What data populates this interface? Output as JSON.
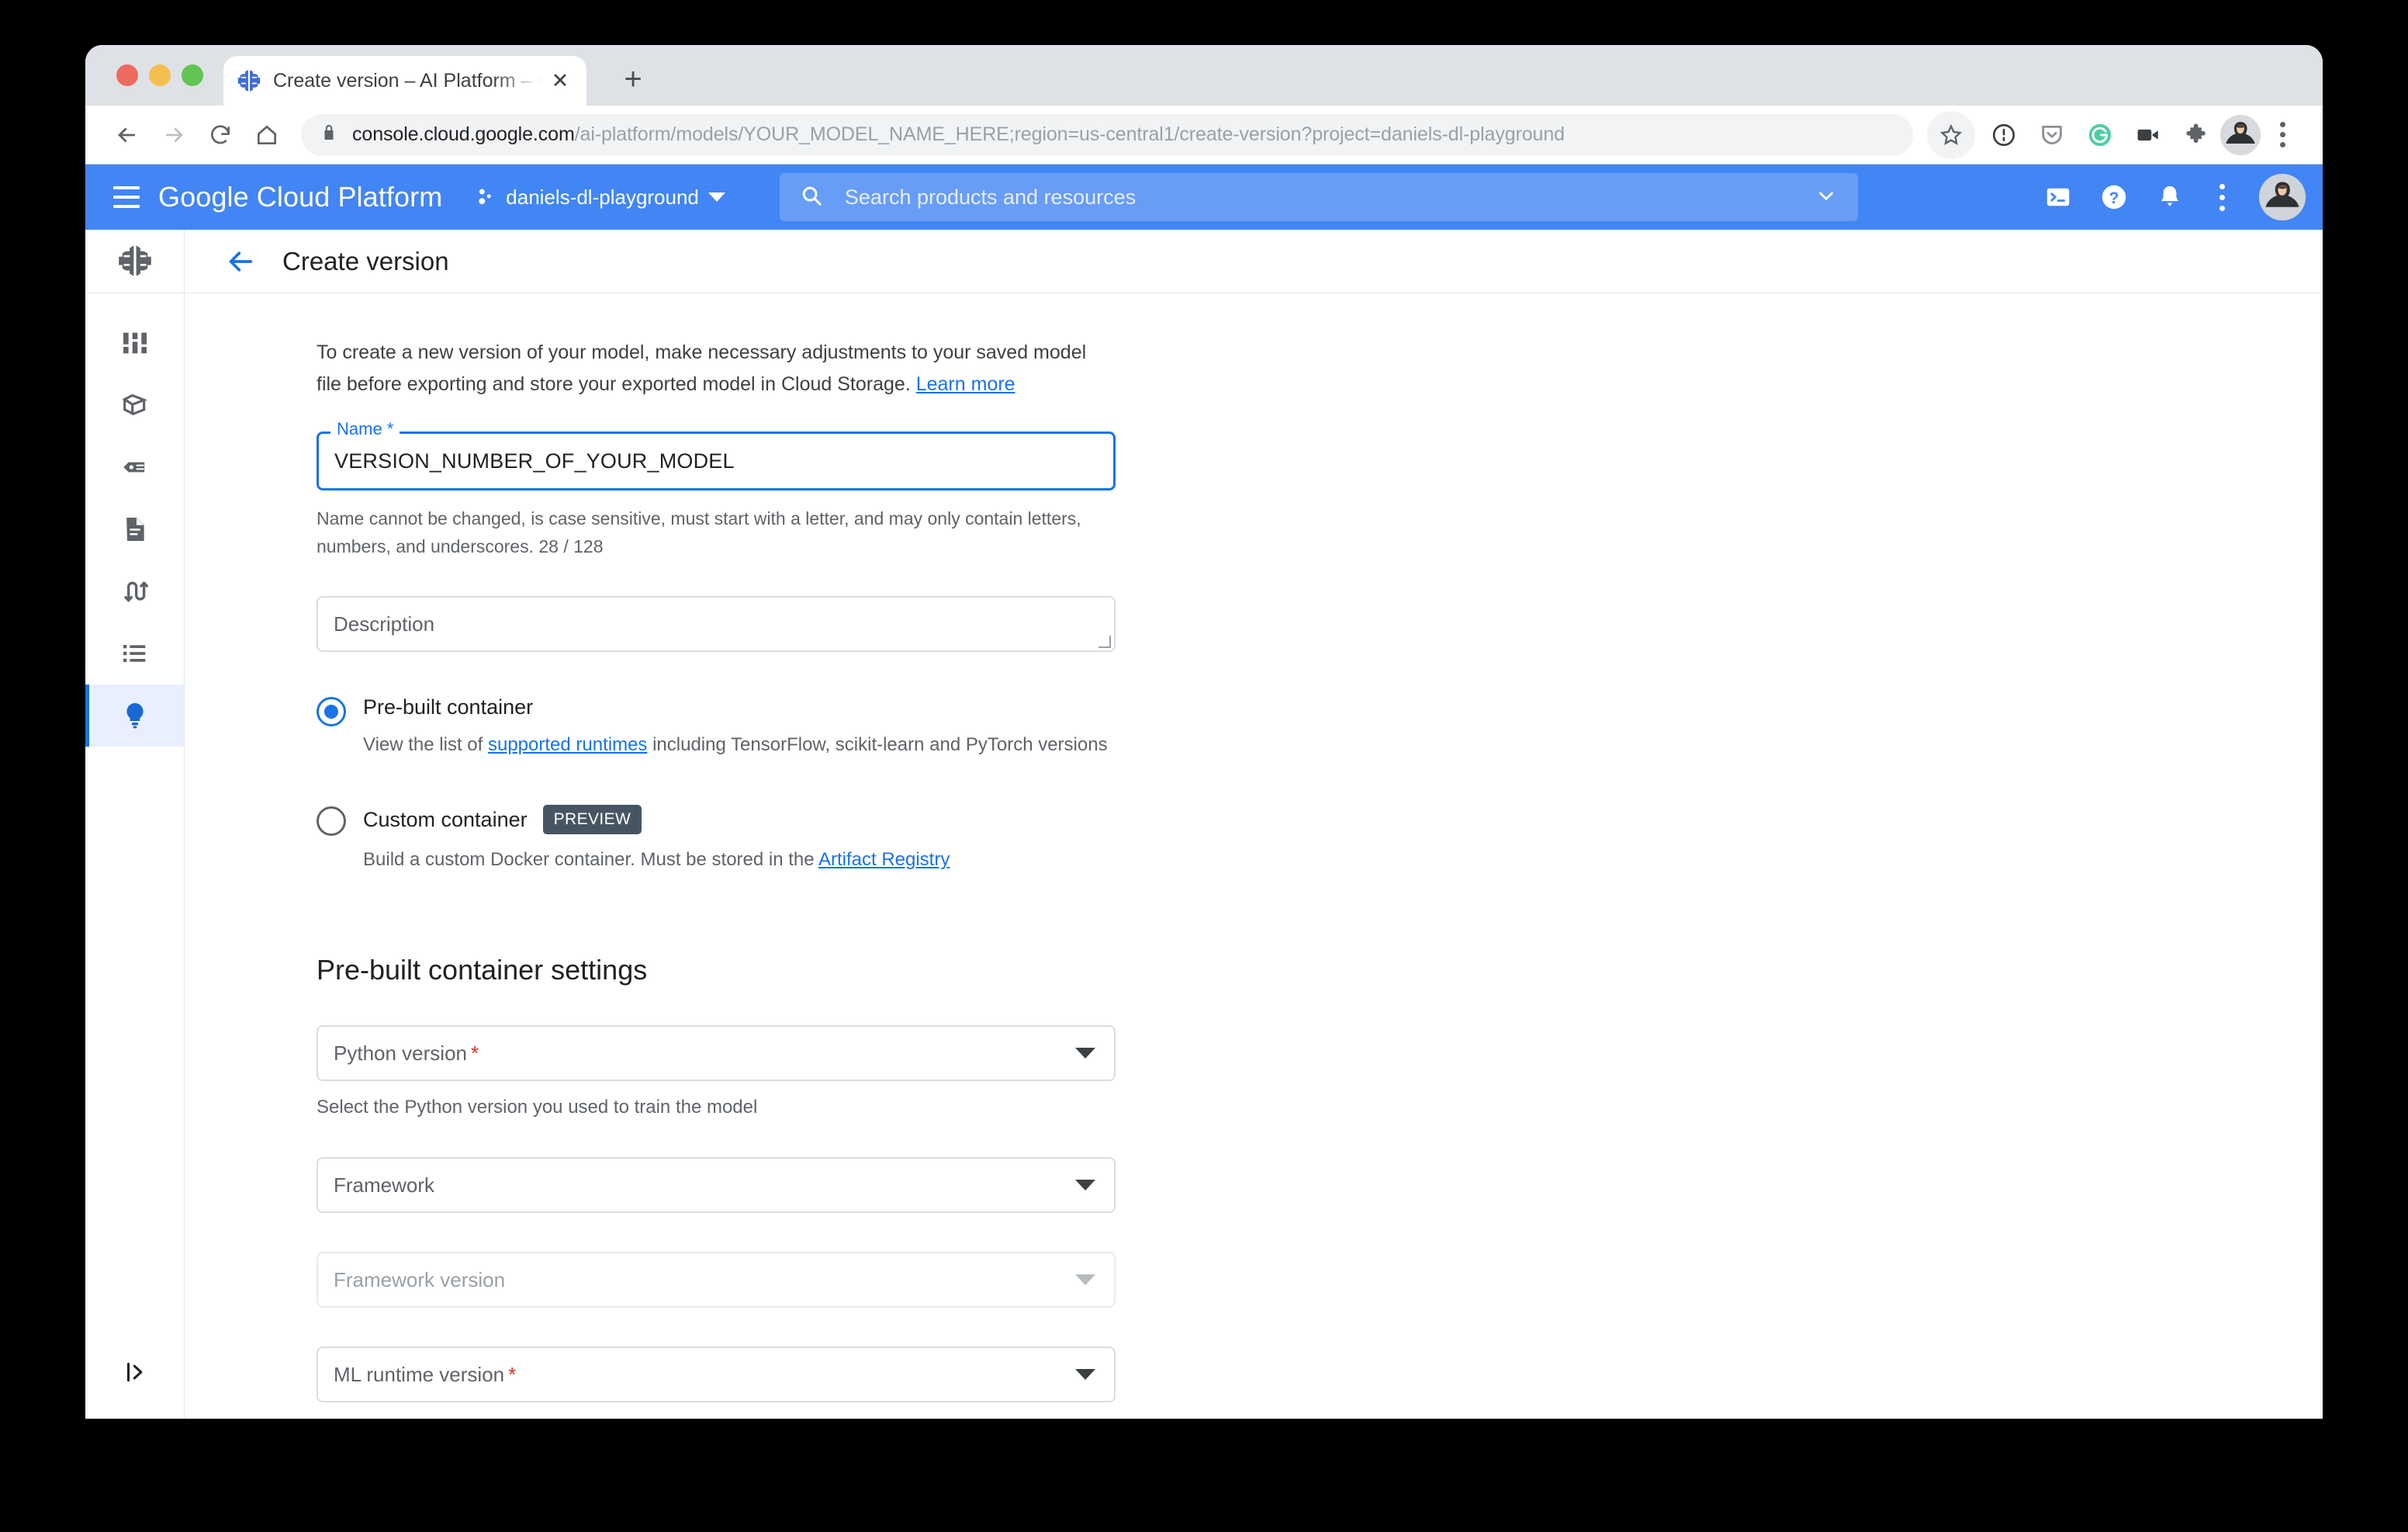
{
  "browser": {
    "tab": {
      "title": "Create version – AI Platform – G",
      "favicon_name": "ai-platform-brain-icon",
      "close_label": "✕",
      "newtab_label": "+"
    },
    "toolbar": {
      "back_label": "←",
      "forward_label": "→",
      "reload_label": "⟳",
      "home_label": "⌂",
      "url_host": "console.cloud.google.com",
      "url_path": "/ai-platform/models/YOUR_MODEL_NAME_HERE;region=us-central1/create-version?project=daniels-dl-playground",
      "extensions": [
        "star-icon",
        "1password-icon",
        "pocket-icon",
        "grammarly-icon",
        "video-camera-icon",
        "extensions-puzzle-icon",
        "profile-avatar",
        "chrome-menu-icon"
      ]
    }
  },
  "gcp_header": {
    "menu_icon": "hamburger-icon",
    "brand": "Google Cloud Platform",
    "project": "daniels-dl-playground",
    "search_placeholder": "Search products and resources",
    "icons": [
      "cloud-shell-icon",
      "help-icon",
      "notifications-icon",
      "more-options-icon",
      "account-avatar"
    ],
    "accent_color": "#4285f4"
  },
  "sidebar": {
    "logo_name": "ai-platform-logo",
    "items": [
      {
        "name": "dashboard-icon",
        "active": false
      },
      {
        "name": "models-icon",
        "active": false
      },
      {
        "name": "labeling-icon",
        "active": false
      },
      {
        "name": "notebooks-icon",
        "active": false
      },
      {
        "name": "jobs-icon",
        "active": false
      },
      {
        "name": "list-icon",
        "active": false
      },
      {
        "name": "lightbulb-icon",
        "active": true
      }
    ],
    "collapse_label": "|>"
  },
  "page": {
    "title": "Create version",
    "back_label": "←",
    "intro": "To create a new version of your model, make necessary adjustments to your saved model file before exporting and store your exported model in Cloud Storage.",
    "intro_link": "Learn more"
  },
  "form": {
    "name": {
      "label": "Name *",
      "value": "VERSION_NUMBER_OF_YOUR_MODEL",
      "helper": "Name cannot be changed, is case sensitive, must start with a letter, and may only contain letters, numbers, and underscores. 28 / 128",
      "focused": true,
      "focus_color": "#1a73e8"
    },
    "description": {
      "placeholder": "Description",
      "value": ""
    },
    "container_options": [
      {
        "label": "Pre-built container",
        "selected": true,
        "sub_before": "View the list of ",
        "sub_link": "supported runtimes",
        "sub_after": " including TensorFlow, scikit-learn and PyTorch versions",
        "badge": ""
      },
      {
        "label": "Custom container",
        "selected": false,
        "badge": "PREVIEW",
        "sub_before": "Build a custom Docker container. Must be stored in the ",
        "sub_link": "Artifact Registry",
        "sub_after": ""
      }
    ],
    "section_title": "Pre-built container settings",
    "selects": [
      {
        "label": "Python version",
        "required": true,
        "value": "",
        "helper": "Select the Python version you used to train the model",
        "disabled": false
      },
      {
        "label": "Framework",
        "required": false,
        "value": "",
        "helper": "",
        "disabled": false
      },
      {
        "label": "Framework version",
        "required": false,
        "value": "",
        "helper": "",
        "disabled": true
      },
      {
        "label": "ML runtime version",
        "required": true,
        "value": "",
        "helper": "",
        "disabled": false
      }
    ]
  }
}
